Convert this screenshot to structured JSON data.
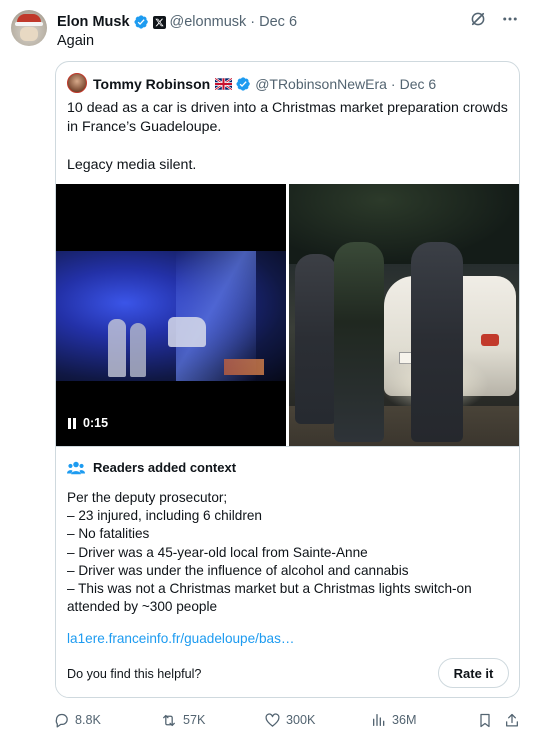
{
  "post": {
    "author": "Elon Musk",
    "handle": "@elonmusk",
    "date": "Dec 6",
    "text": "Again"
  },
  "quoted": {
    "author": "Tommy Robinson",
    "handle": "@TRobinsonNewEra",
    "date": "Dec 6",
    "paragraph1": "10 dead as a car is driven into a Christmas market preparation crowds in France’s Guadeloupe.",
    "paragraph2": "Legacy media silent.",
    "video_time": "0:15"
  },
  "context": {
    "title": "Readers added context",
    "lines": [
      "Per the deputy prosecutor;",
      "– 23 injured, including 6 children",
      "– No fatalities",
      "– Driver was a 45-year-old local from Sainte-Anne",
      "– Driver was under the influence of alcohol and cannabis",
      "– This was not a Christmas market but a Christmas lights switch-on attended by ~300 people"
    ],
    "link": "la1ere.franceinfo.fr/guadeloupe/bas…",
    "helpful_question": "Do you find this helpful?",
    "rate_label": "Rate it"
  },
  "actions": {
    "replies": "8.8K",
    "reposts": "57K",
    "likes": "300K",
    "views": "36M"
  },
  "colors": {
    "verified": "#1d9bf0",
    "link": "#1d9bf0",
    "muted": "#536471",
    "border": "#cfd9de"
  }
}
